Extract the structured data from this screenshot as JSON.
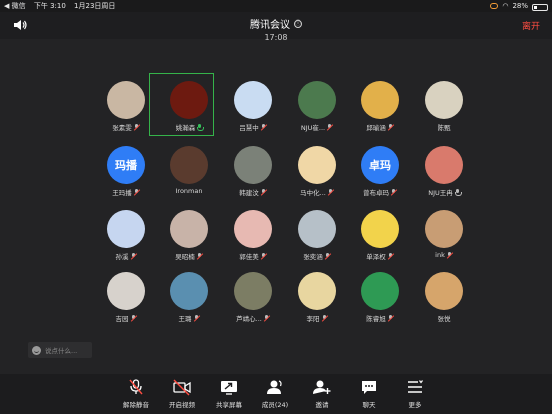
{
  "status_bar": {
    "carrier": "◀ 微信",
    "time": "下午 3:10",
    "date": "1月23日周日",
    "battery": "28%",
    "battery_level": 0.28
  },
  "header": {
    "title": "腾讯会议",
    "info_icon": "ⓘ",
    "time": "17:08",
    "leave_label": "离开"
  },
  "participants": [
    {
      "name": "张素雯",
      "avatar_text": "",
      "avatar_color": "#c9b7a3",
      "mic": "muted"
    },
    {
      "name": "姚瀚森",
      "avatar_text": "",
      "avatar_color": "#6d1a10",
      "mic": "active"
    },
    {
      "name": "吕慧中",
      "avatar_text": "",
      "avatar_color": "#c9dcf2",
      "mic": "muted"
    },
    {
      "name": "NJU崔...",
      "avatar_text": "",
      "avatar_color": "#4c7a4e",
      "mic": "muted"
    },
    {
      "name": "邱瑜涵",
      "avatar_text": "",
      "avatar_color": "#e2b04a",
      "mic": "muted"
    },
    {
      "name": "陈甄",
      "avatar_text": "",
      "avatar_color": "#d9d2c0",
      "mic": "none"
    },
    {
      "name": "王玛播",
      "avatar_text": "玛播",
      "avatar_color": "#2f7df6",
      "mic": "muted"
    },
    {
      "name": "Ironman",
      "avatar_text": "",
      "avatar_color": "#5a3b2e",
      "mic": "none"
    },
    {
      "name": "韩建汶",
      "avatar_text": "",
      "avatar_color": "#7b8178",
      "mic": "muted"
    },
    {
      "name": "马中化...",
      "avatar_text": "",
      "avatar_color": "#f0d7a6",
      "mic": "muted"
    },
    {
      "name": "曾布卓玛",
      "avatar_text": "卓玛",
      "avatar_color": "#2f7df6",
      "mic": "muted"
    },
    {
      "name": "NJU王冉",
      "avatar_text": "",
      "avatar_color": "#d97a6c",
      "mic": "on"
    },
    {
      "name": "孙溪",
      "avatar_text": "",
      "avatar_color": "#c6d6f0",
      "mic": "muted"
    },
    {
      "name": "吴昭楠",
      "avatar_text": "",
      "avatar_color": "#c8b3a8",
      "mic": "muted"
    },
    {
      "name": "郭佳美",
      "avatar_text": "",
      "avatar_color": "#e7b9b2",
      "mic": "muted"
    },
    {
      "name": "张奕涵",
      "avatar_text": "",
      "avatar_color": "#b6c0c8",
      "mic": "muted"
    },
    {
      "name": "单泽权",
      "avatar_text": "",
      "avatar_color": "#f2d34b",
      "mic": "muted"
    },
    {
      "name": "ink",
      "avatar_text": "",
      "avatar_color": "#c89d74",
      "mic": "muted"
    },
    {
      "name": "吉园",
      "avatar_text": "",
      "avatar_color": "#d7d2cc",
      "mic": "muted"
    },
    {
      "name": "王璐",
      "avatar_text": "",
      "avatar_color": "#5a8fb0",
      "mic": "muted"
    },
    {
      "name": "芦靖心...",
      "avatar_text": "",
      "avatar_color": "#7c7d64",
      "mic": "muted"
    },
    {
      "name": "李阳",
      "avatar_text": "",
      "avatar_color": "#e8d6a0",
      "mic": "muted"
    },
    {
      "name": "陈睿旭",
      "avatar_text": "",
      "avatar_color": "#2e9a54",
      "mic": "muted"
    },
    {
      "name": "张悦",
      "avatar_text": "",
      "avatar_color": "#d6a56b",
      "mic": "none"
    }
  ],
  "chat": {
    "placeholder": "说点什么..."
  },
  "toolbar": {
    "unmute_label": "解除静音",
    "video_label": "开启视频",
    "share_label": "共享屏幕",
    "members_label": "成员(24)",
    "invite_label": "邀请",
    "chat_label": "聊天",
    "more_label": "更多"
  },
  "colors": {
    "accent_green": "#35b34a",
    "leave_red": "#ff4d42",
    "background": "#232325"
  }
}
